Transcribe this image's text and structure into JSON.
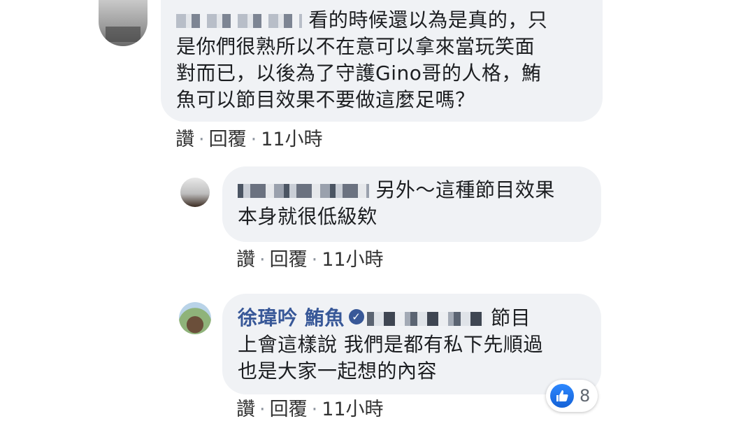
{
  "comments": [
    {
      "text_suffix": "看的時候還以為是真的，只",
      "lines": [
        "是你們很熟所以不在意可以拿來當玩笑面",
        "對而已，以後為了守護Gino哥的人格，鮪",
        "魚可以節目效果不要做這麼足嗎？"
      ],
      "actions": {
        "like": "讚",
        "reply": "回覆",
        "time": "11小時"
      }
    },
    {
      "text_suffix": "另外～這種節目效果",
      "lines": [
        "本身就很低級欸"
      ],
      "actions": {
        "like": "讚",
        "reply": "回覆",
        "time": "11小時"
      }
    },
    {
      "author": "徐瑋吟 鮪魚",
      "text_suffix": "節目",
      "lines": [
        "上會這樣說 我們是都有私下先順過",
        "也是大家一起想的內容"
      ],
      "actions": {
        "like": "讚",
        "reply": "回覆",
        "time": "11小時"
      },
      "reaction": {
        "icon": "like-icon",
        "count": "8"
      }
    }
  ],
  "colors": {
    "bubble": "#f0f2f5",
    "author": "#385898",
    "like": "#1877f2"
  }
}
